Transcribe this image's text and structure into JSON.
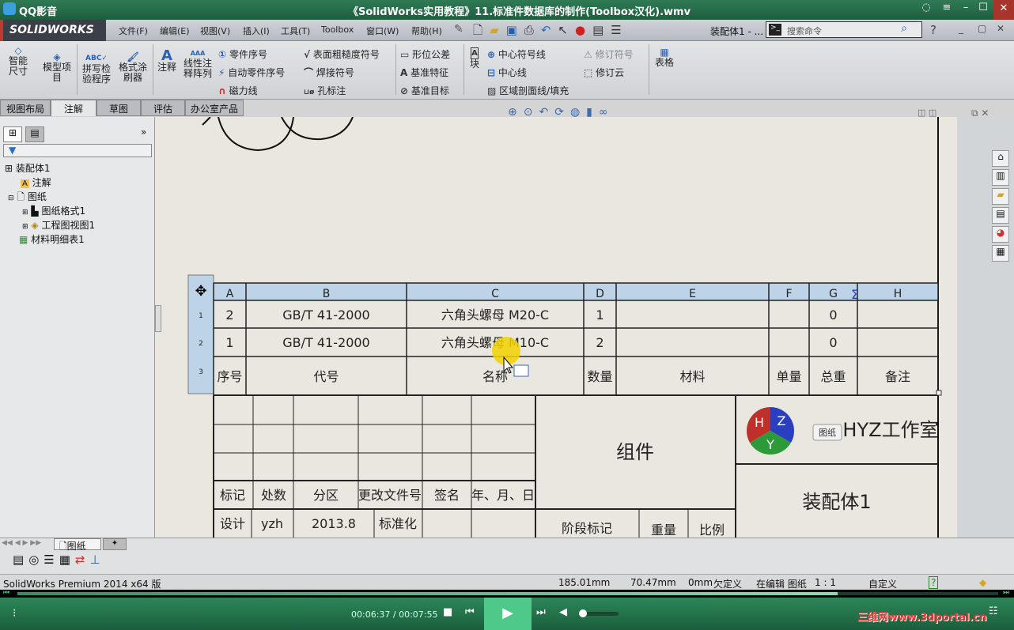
{
  "player": {
    "app_name": "QQ影音",
    "title": "《SolidWorks实用教程》11.标准件数据库的制作(Toolbox汉化).wmv",
    "time": "00:06:37 / 00:07:55",
    "progress": 0.836,
    "watermark": "三维网www.3dportal.cn"
  },
  "menubar": {
    "logo": "SOLIDWORKS",
    "items": [
      "文件(F)",
      "编辑(E)",
      "视图(V)",
      "插入(I)",
      "工具(T)",
      "Toolbox",
      "窗口(W)",
      "帮助(H)"
    ],
    "doc_title": "装配体1 - ...",
    "search_placeholder": "搜索命令"
  },
  "ribbon": {
    "big": [
      "智能尺寸",
      "模型项目",
      "拼写检验程序",
      "格式涂刷器",
      "注释",
      "线性注释阵列"
    ],
    "col1": [
      "零件序号",
      "自动零件序号",
      "磁力线"
    ],
    "col2": [
      "表面粗糙度符号",
      "焊接符号",
      "孔标注"
    ],
    "col3": [
      "形位公差",
      "基准特征",
      "基准目标"
    ],
    "block": "块",
    "col4": [
      "中心符号线",
      "中心线",
      "区域剖面线/填充"
    ],
    "col5": [
      "修订符号",
      "修订云"
    ],
    "table": "表格"
  },
  "tabs": [
    "视图布局",
    "注解",
    "草图",
    "评估",
    "办公室产品"
  ],
  "tree": {
    "root": "装配体1",
    "items": [
      "注解",
      "图纸",
      "图纸格式1",
      "工程图视图1",
      "材料明细表1"
    ]
  },
  "bom": {
    "columns": [
      "A",
      "B",
      "C",
      "D",
      "E",
      "F",
      "G",
      "H"
    ],
    "row_numbers": [
      "1",
      "2",
      "3"
    ],
    "rows": [
      [
        "2",
        "GB/T 41-2000",
        "六角头螺母 M20-C",
        "1",
        "",
        "",
        "0",
        ""
      ],
      [
        "1",
        "GB/T 41-2000",
        "六角头螺母 M10-C",
        "2",
        "",
        "",
        "0",
        ""
      ]
    ],
    "header": [
      "序号",
      "代号",
      "名称",
      "数量",
      "材料",
      "单量",
      "总重",
      "备注"
    ]
  },
  "titleblock": {
    "labels": [
      "标记",
      "处数",
      "分区",
      "更改文件号",
      "签名",
      "年、月、日"
    ],
    "design": [
      "设计",
      "yzh",
      "2013.8",
      "标准化"
    ],
    "part_type": "组件",
    "stage": "阶段标记",
    "weight": "重量",
    "scale": "比例",
    "company": "HYZ工作室",
    "logo_letters": [
      "H",
      "Z",
      "Y"
    ],
    "drawing_name": "装配体1",
    "tooltip": "图纸"
  },
  "sheet_tab": "图纸",
  "status": {
    "product": "SolidWorks Premium 2014 x64 版",
    "x": "185.01mm",
    "y": "70.47mm",
    "z": "0mm",
    "state": "欠定义",
    "mode": "在编辑 图纸",
    "scale": "1 : 1",
    "units": "自定义"
  }
}
